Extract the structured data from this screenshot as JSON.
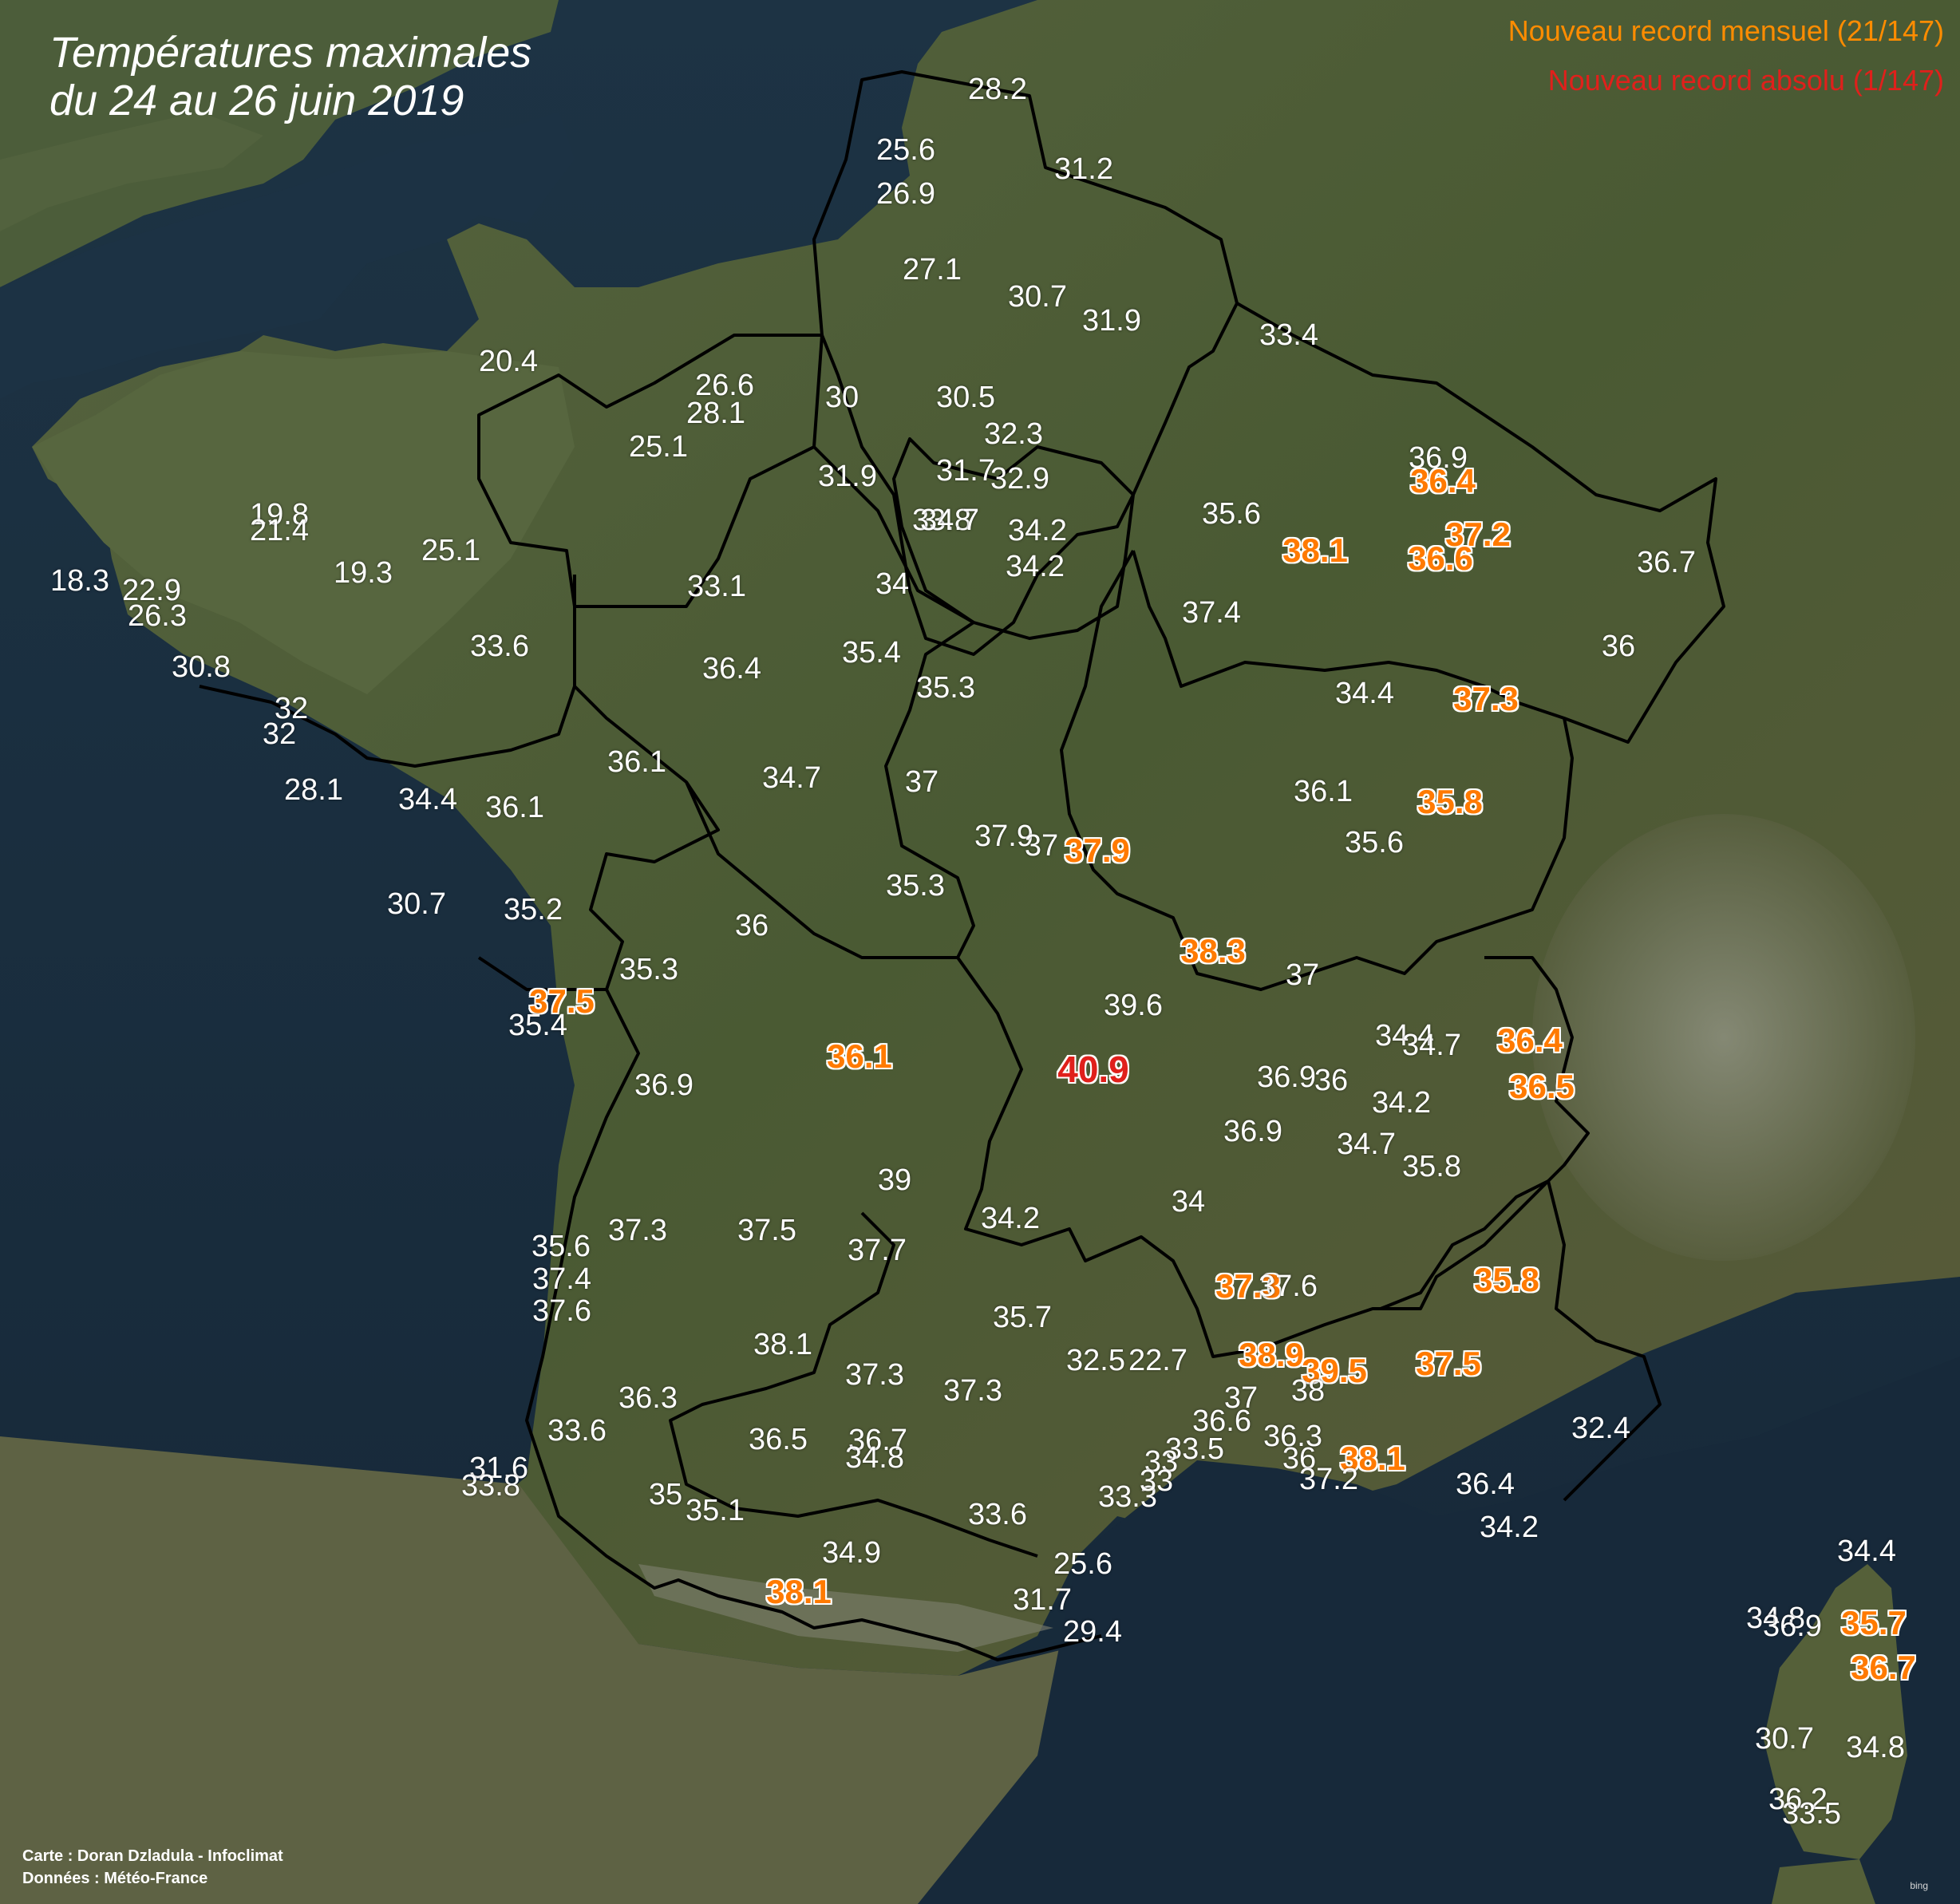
{
  "map": {
    "title_line1": "Températures maximales",
    "title_line2": "du 24 au 26 juin 2019",
    "legend_monthly": "Nouveau record mensuel (21/147)",
    "legend_absolute": "Nouveau record absolu (1/147)",
    "credit_map": "Carte : Doran Dzladula - Infoclimat",
    "credit_data": "Données : Météo-France",
    "attribution": "bing",
    "colors": {
      "normal": "#ffffff",
      "monthly_record": "#ff7a00",
      "absolute_record": "#e0201b",
      "sea": "#1b2c3a",
      "land": "#4a5a35",
      "borders": "#000000"
    },
    "values": [
      {
        "v": "28.2",
        "k": "n"
      },
      {
        "v": "25.6",
        "k": "n"
      },
      {
        "v": "26.9",
        "k": "n"
      },
      {
        "v": "31.2",
        "k": "n"
      },
      {
        "v": "27.1",
        "k": "n"
      },
      {
        "v": "30.7",
        "k": "n"
      },
      {
        "v": "31.9",
        "k": "n"
      },
      {
        "v": "33.4",
        "k": "n"
      },
      {
        "v": "20.4",
        "k": "n"
      },
      {
        "v": "26.6",
        "k": "n"
      },
      {
        "v": "28.1",
        "k": "n"
      },
      {
        "v": "30",
        "k": "n"
      },
      {
        "v": "30.5",
        "k": "n"
      },
      {
        "v": "25.1",
        "k": "n"
      },
      {
        "v": "32.3",
        "k": "n"
      },
      {
        "v": "31.9",
        "k": "n"
      },
      {
        "v": "31.7",
        "k": "n"
      },
      {
        "v": "32.9",
        "k": "n"
      },
      {
        "v": "36.9",
        "k": "n"
      },
      {
        "v": "36.4",
        "k": "m"
      },
      {
        "v": "19.8",
        "k": "n"
      },
      {
        "v": "21.4",
        "k": "n"
      },
      {
        "v": "33.8",
        "k": "n"
      },
      {
        "v": "34.7",
        "k": "n"
      },
      {
        "v": "34.2",
        "k": "n"
      },
      {
        "v": "35.6",
        "k": "n"
      },
      {
        "v": "37.2",
        "k": "m"
      },
      {
        "v": "38.1",
        "k": "m"
      },
      {
        "v": "25.1",
        "k": "n"
      },
      {
        "v": "36.6",
        "k": "m"
      },
      {
        "v": "36.7",
        "k": "n"
      },
      {
        "v": "18.3",
        "k": "n"
      },
      {
        "v": "22.9",
        "k": "n"
      },
      {
        "v": "19.3",
        "k": "n"
      },
      {
        "v": "33.1",
        "k": "n"
      },
      {
        "v": "34",
        "k": "n"
      },
      {
        "v": "34.2",
        "k": "n"
      },
      {
        "v": "26.3",
        "k": "n"
      },
      {
        "v": "37.4",
        "k": "n"
      },
      {
        "v": "33.6",
        "k": "n"
      },
      {
        "v": "35.4",
        "k": "n"
      },
      {
        "v": "36",
        "k": "n"
      },
      {
        "v": "30.8",
        "k": "n"
      },
      {
        "v": "36.4",
        "k": "n"
      },
      {
        "v": "35.3",
        "k": "n"
      },
      {
        "v": "34.4",
        "k": "n"
      },
      {
        "v": "37.3",
        "k": "m"
      },
      {
        "v": "32",
        "k": "n"
      },
      {
        "v": "32",
        "k": "n"
      },
      {
        "v": "36.1",
        "k": "n"
      },
      {
        "v": "28.1",
        "k": "n"
      },
      {
        "v": "34.4",
        "k": "n"
      },
      {
        "v": "36.1",
        "k": "n"
      },
      {
        "v": "34.7",
        "k": "n"
      },
      {
        "v": "37",
        "k": "n"
      },
      {
        "v": "36.1",
        "k": "n"
      },
      {
        "v": "35.8",
        "k": "m"
      },
      {
        "v": "37.9",
        "k": "n"
      },
      {
        "v": "37",
        "k": "n"
      },
      {
        "v": "37.9",
        "k": "m"
      },
      {
        "v": "35.6",
        "k": "n"
      },
      {
        "v": "30.7",
        "k": "n"
      },
      {
        "v": "35.2",
        "k": "n"
      },
      {
        "v": "35.3",
        "k": "n"
      },
      {
        "v": "36",
        "k": "n"
      },
      {
        "v": "38.3",
        "k": "m"
      },
      {
        "v": "37",
        "k": "n"
      },
      {
        "v": "35.3",
        "k": "n"
      },
      {
        "v": "37.5",
        "k": "m"
      },
      {
        "v": "35.4",
        "k": "n"
      },
      {
        "v": "39.6",
        "k": "n"
      },
      {
        "v": "34.4",
        "k": "n"
      },
      {
        "v": "34.7",
        "k": "n"
      },
      {
        "v": "36.4",
        "k": "m"
      },
      {
        "v": "36.1",
        "k": "m"
      },
      {
        "v": "40.9",
        "k": "a"
      },
      {
        "v": "36.9",
        "k": "n"
      },
      {
        "v": "36",
        "k": "n"
      },
      {
        "v": "36.5",
        "k": "m"
      },
      {
        "v": "36.9",
        "k": "n"
      },
      {
        "v": "34.2",
        "k": "n"
      },
      {
        "v": "36.9",
        "k": "n"
      },
      {
        "v": "34.7",
        "k": "n"
      },
      {
        "v": "35.8",
        "k": "n"
      },
      {
        "v": "39",
        "k": "n"
      },
      {
        "v": "34",
        "k": "n"
      },
      {
        "v": "34.2",
        "k": "n"
      },
      {
        "v": "37.3",
        "k": "n"
      },
      {
        "v": "37.5",
        "k": "n"
      },
      {
        "v": "35.6",
        "k": "n"
      },
      {
        "v": "37.7",
        "k": "n"
      },
      {
        "v": "37.4",
        "k": "n"
      },
      {
        "v": "37.3",
        "k": "m"
      },
      {
        "v": "37.6",
        "k": "n"
      },
      {
        "v": "35.8",
        "k": "m"
      },
      {
        "v": "37.6",
        "k": "n"
      },
      {
        "v": "35.7",
        "k": "n"
      },
      {
        "v": "38.1",
        "k": "n"
      },
      {
        "v": "38.9",
        "k": "m"
      },
      {
        "v": "39.5",
        "k": "m"
      },
      {
        "v": "37.5",
        "k": "m"
      },
      {
        "v": "37.3",
        "k": "n"
      },
      {
        "v": "32.5",
        "k": "n"
      },
      {
        "v": "22.7",
        "k": "n"
      },
      {
        "v": "36.3",
        "k": "n"
      },
      {
        "v": "37.3",
        "k": "n"
      },
      {
        "v": "37",
        "k": "n"
      },
      {
        "v": "38",
        "k": "n"
      },
      {
        "v": "36.6",
        "k": "n"
      },
      {
        "v": "32.4",
        "k": "n"
      },
      {
        "v": "33.6",
        "k": "n"
      },
      {
        "v": "36.5",
        "k": "n"
      },
      {
        "v": "36.7",
        "k": "n"
      },
      {
        "v": "36.3",
        "k": "n"
      },
      {
        "v": "33.5",
        "k": "n"
      },
      {
        "v": "33",
        "k": "n"
      },
      {
        "v": "34.8",
        "k": "n"
      },
      {
        "v": "36",
        "k": "n"
      },
      {
        "v": "38.1",
        "k": "m"
      },
      {
        "v": "31.6",
        "k": "n"
      },
      {
        "v": "33.8",
        "k": "n"
      },
      {
        "v": "37.2",
        "k": "n"
      },
      {
        "v": "36.4",
        "k": "n"
      },
      {
        "v": "35",
        "k": "n"
      },
      {
        "v": "35.1",
        "k": "n"
      },
      {
        "v": "33.6",
        "k": "n"
      },
      {
        "v": "33.3",
        "k": "n"
      },
      {
        "v": "33",
        "k": "n"
      },
      {
        "v": "34.2",
        "k": "n"
      },
      {
        "v": "34.9",
        "k": "n"
      },
      {
        "v": "25.6",
        "k": "n"
      },
      {
        "v": "34.4",
        "k": "n"
      },
      {
        "v": "38.1",
        "k": "m"
      },
      {
        "v": "31.7",
        "k": "n"
      },
      {
        "v": "34.8",
        "k": "n"
      },
      {
        "v": "35.7",
        "k": "m"
      },
      {
        "v": "29.4",
        "k": "n"
      },
      {
        "v": "36.9",
        "k": "n"
      },
      {
        "v": "36.7",
        "k": "m"
      },
      {
        "v": "30.7",
        "k": "n"
      },
      {
        "v": "34.8",
        "k": "n"
      },
      {
        "v": "36.2",
        "k": "n"
      },
      {
        "v": "33.5",
        "k": "n"
      }
    ]
  }
}
